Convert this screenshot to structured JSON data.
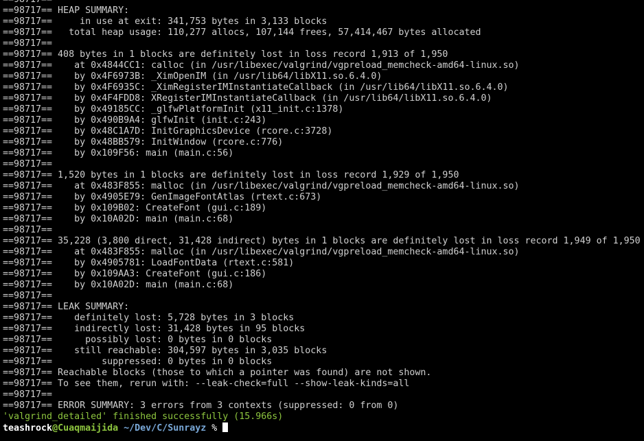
{
  "colors": {
    "background": "#000000",
    "text": "#d0d0d0",
    "success": "#8ec63f",
    "user": "#ffffff",
    "host": "#8ec63f",
    "path": "#79a8d8"
  },
  "terminal": {
    "lines": [
      "==98717==",
      "==98717== HEAP SUMMARY:",
      "==98717==     in use at exit: 341,753 bytes in 3,133 blocks",
      "==98717==   total heap usage: 110,277 allocs, 107,144 frees, 57,414,467 bytes allocated",
      "==98717==",
      "==98717== 408 bytes in 1 blocks are definitely lost in loss record 1,913 of 1,950",
      "==98717==    at 0x4844CC1: calloc (in /usr/libexec/valgrind/vgpreload_memcheck-amd64-linux.so)",
      "==98717==    by 0x4F6973B: _XimOpenIM (in /usr/lib64/libX11.so.6.4.0)",
      "==98717==    by 0x4F6935C: _XimRegisterIMInstantiateCallback (in /usr/lib64/libX11.so.6.4.0)",
      "==98717==    by 0x4F4FDD8: XRegisterIMInstantiateCallback (in /usr/lib64/libX11.so.6.4.0)",
      "==98717==    by 0x49185CC: _glfwPlatformInit (x11_init.c:1378)",
      "==98717==    by 0x490B9A4: glfwInit (init.c:243)",
      "==98717==    by 0x48C1A7D: InitGraphicsDevice (rcore.c:3728)",
      "==98717==    by 0x48BB579: InitWindow (rcore.c:776)",
      "==98717==    by 0x109F56: main (main.c:56)",
      "==98717==",
      "==98717== 1,520 bytes in 1 blocks are definitely lost in loss record 1,929 of 1,950",
      "==98717==    at 0x483F855: malloc (in /usr/libexec/valgrind/vgpreload_memcheck-amd64-linux.so)",
      "==98717==    by 0x4905E79: GenImageFontAtlas (rtext.c:673)",
      "==98717==    by 0x109B02: CreateFont (gui.c:189)",
      "==98717==    by 0x10A02D: main (main.c:68)",
      "==98717==",
      "==98717== 35,228 (3,800 direct, 31,428 indirect) bytes in 1 blocks are definitely lost in loss record 1,949 of 1,950",
      "==98717==    at 0x483F855: malloc (in /usr/libexec/valgrind/vgpreload_memcheck-amd64-linux.so)",
      "==98717==    by 0x4905781: LoadFontData (rtext.c:581)",
      "==98717==    by 0x109AA3: CreateFont (gui.c:186)",
      "==98717==    by 0x10A02D: main (main.c:68)",
      "==98717==",
      "==98717== LEAK SUMMARY:",
      "==98717==    definitely lost: 5,728 bytes in 3 blocks",
      "==98717==    indirectly lost: 31,428 bytes in 95 blocks",
      "==98717==      possibly lost: 0 bytes in 0 blocks",
      "==98717==    still reachable: 304,597 bytes in 3,035 blocks",
      "==98717==         suppressed: 0 bytes in 0 blocks",
      "==98717== Reachable blocks (those to which a pointer was found) are not shown.",
      "==98717== To see them, rerun with: --leak-check=full --show-leak-kinds=all",
      "==98717==",
      "==98717== ERROR SUMMARY: 3 errors from 3 contexts (suppressed: 0 from 0)"
    ],
    "status_line": "'valgrind_detailed' finished successfully (15.966s)",
    "prompt": {
      "user": "teashrock",
      "at": "@",
      "host": "Cuaqmaijida",
      "path": "~/Dev/C/Sunrayz",
      "symbol": "%"
    }
  }
}
